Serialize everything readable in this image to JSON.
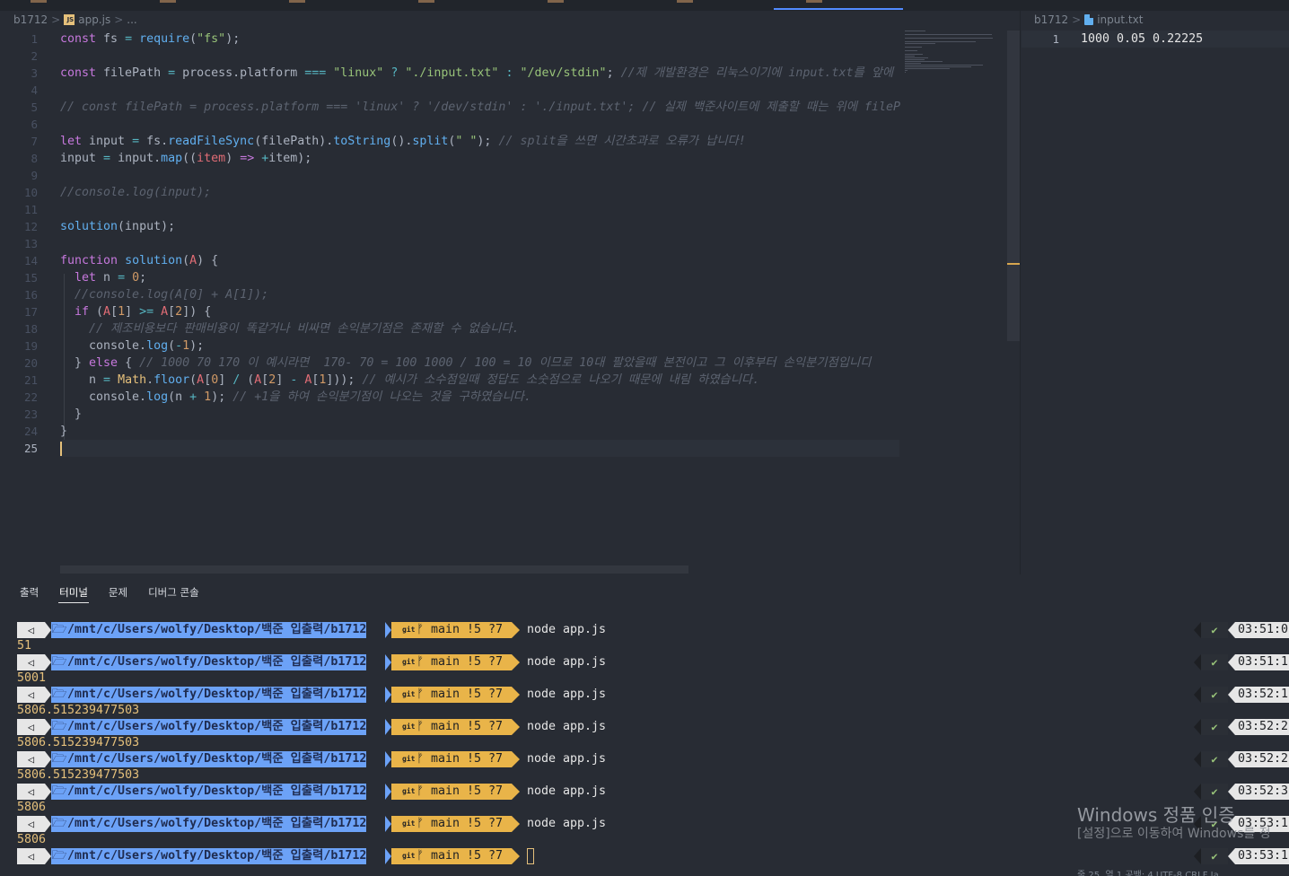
{
  "breadcrumb_left": {
    "folder": "b1712",
    "sep": ">",
    "file": "app.js",
    "trail": "..."
  },
  "breadcrumb_right": {
    "folder": "b1712",
    "sep": ">",
    "file": "input.txt"
  },
  "editor": {
    "lines": [
      {
        "n": "1",
        "html": "<span class=\"kw\">const</span> fs <span class=\"op\">=</span> <span class=\"fn\">require</span>(<span class=\"st\">\"fs\"</span>);"
      },
      {
        "n": "2",
        "html": ""
      },
      {
        "n": "3",
        "html": "<span class=\"kw\">const</span> filePath <span class=\"op\">=</span> process.platform <span class=\"op\">===</span> <span class=\"st\">\"linux\"</span> <span class=\"op\">?</span> <span class=\"st\">\"./input.txt\"</span> <span class=\"op\">:</span> <span class=\"st\">\"/dev/stdin\"</span>; <span class=\"cm\">//제 개발환경은 리눅스이기에 input.txt를 앞에</span>"
      },
      {
        "n": "4",
        "html": ""
      },
      {
        "n": "5",
        "html": "<span class=\"cm\">// const filePath = process.platform === 'linux' ? '/dev/stdin' : './input.txt'; // 실제 백준사이트에 제출할 때는 위에 fileP</span>"
      },
      {
        "n": "6",
        "html": ""
      },
      {
        "n": "7",
        "html": "<span class=\"kw\">let</span> input <span class=\"op\">=</span> fs.<span class=\"fn\">readFileSync</span>(filePath).<span class=\"fn\">toString</span>().<span class=\"fn\">split</span>(<span class=\"st\">\" \"</span>); <span class=\"cm\">// split을 쓰면 시간초과로 오류가 납니다!</span>"
      },
      {
        "n": "8",
        "html": "input <span class=\"op\">=</span> input.<span class=\"fn\">map</span>((<span class=\"pm\">item</span>) <span class=\"kw\">=&gt;</span> <span class=\"op\">+</span>item);"
      },
      {
        "n": "9",
        "html": ""
      },
      {
        "n": "10",
        "html": "<span class=\"cm\">//console.log(input);</span>"
      },
      {
        "n": "11",
        "html": ""
      },
      {
        "n": "12",
        "html": "<span class=\"fn\">solution</span>(input);"
      },
      {
        "n": "13",
        "html": ""
      },
      {
        "n": "14",
        "html": "<span class=\"kw\">function</span> <span class=\"fn\">solution</span>(<span class=\"pm\">A</span>) {"
      },
      {
        "n": "15",
        "html": "  <span class=\"kw\">let</span> n <span class=\"op\">=</span> <span class=\"nm\">0</span>;"
      },
      {
        "n": "16",
        "html": "  <span class=\"cm\">//console.log(A[0] + A[1]);</span>"
      },
      {
        "n": "17",
        "html": "  <span class=\"kw\">if</span> (<span class=\"pm\">A</span>[<span class=\"nm\">1</span>] <span class=\"op\">&gt;=</span> <span class=\"pm\">A</span>[<span class=\"nm\">2</span>]) {"
      },
      {
        "n": "18",
        "html": "    <span class=\"cm\">// 제조비용보다 판매비용이 똑같거나 비싸면 손익분기점은 존재할 수 없습니다.</span>"
      },
      {
        "n": "19",
        "html": "    console.<span class=\"fn\">log</span>(<span class=\"op\">-</span><span class=\"nm\">1</span>);"
      },
      {
        "n": "20",
        "html": "  } <span class=\"kw\">else</span> { <span class=\"cm\">// 1000 70 170 이 예시라면  170- 70 = 100 1000 / 100 = 10 이므로 10대 팔았을때 본전이고 그 이후부터 손익분기점입니디</span>"
      },
      {
        "n": "21",
        "html": "    n <span class=\"op\">=</span> <span class=\"vr\">Math</span>.<span class=\"fn\">floor</span>(<span class=\"pm\">A</span>[<span class=\"nm\">0</span>] <span class=\"op\">/</span> (<span class=\"pm\">A</span>[<span class=\"nm\">2</span>] <span class=\"op\">-</span> <span class=\"pm\">A</span>[<span class=\"nm\">1</span>])); <span class=\"cm\">// 예시가 소수점일때 정답도 소숫점으로 나오기 때문에 내림 하였습니다.</span>"
      },
      {
        "n": "22",
        "html": "    console.<span class=\"fn\">log</span>(n <span class=\"op\">+</span> <span class=\"nm\">1</span>); <span class=\"cm\">// +1을 하여 손익분기점이 나오는 것을 구하였습니다.</span>"
      },
      {
        "n": "23",
        "html": "  }"
      },
      {
        "n": "24",
        "html": "}"
      },
      {
        "n": "25",
        "html": ""
      }
    ]
  },
  "input_file": {
    "line_no": "1",
    "content": "1000 0.05 0.22225"
  },
  "panel_tabs": [
    "출력",
    "터미널",
    "문제",
    "디버그 콘솔"
  ],
  "terminal": {
    "prompt_icon": "◁",
    "folder_icon": "🗁",
    "path": "/mnt/c/Users/wolfy/Desktop/백준 입출력/b1712",
    "git_label": "git",
    "branch_icon": "ᚠ",
    "branch": "main !5 ?7",
    "check": "✔",
    "entries": [
      {
        "command": "node app.js",
        "time": "03:51:0",
        "output": "51"
      },
      {
        "command": "node app.js",
        "time": "03:51:1",
        "output": "5001"
      },
      {
        "command": "node app.js",
        "time": "03:52:1",
        "output": "5806.515239477503"
      },
      {
        "command": "node app.js",
        "time": "03:52:2",
        "output": "5806.515239477503"
      },
      {
        "command": "node app.js",
        "time": "03:52:2",
        "output": "5806.515239477503"
      },
      {
        "command": "node app.js",
        "time": "03:52:3",
        "output": "5806"
      },
      {
        "command": "node app.js",
        "time": "03:53:1",
        "output": "5806"
      },
      {
        "command": "",
        "time": "03:53:1",
        "output": ""
      }
    ]
  },
  "watermark": {
    "title": "Windows 정품 인증",
    "subtitle": "[설정]으로 이동하여 Windows를 정"
  },
  "statusbar": "줄 25, 열 1    공백: 4    UTF-8    CRLF    Ja"
}
